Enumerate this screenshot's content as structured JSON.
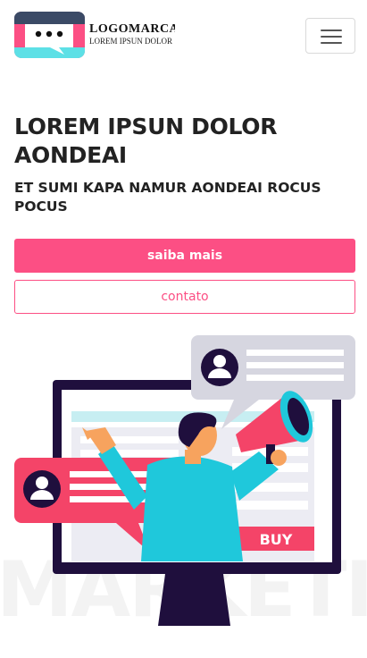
{
  "header": {
    "logo_name": "LOGOMARCA",
    "logo_tagline": "LOREM IPSUN DOLOR",
    "menu_icon": "hamburger-menu-icon"
  },
  "hero": {
    "title": "LOREM IPSUN DOLOR AONDEAI",
    "subtitle": "ET SUMI KAPA NAMUR AONDEAI ROCUS POCUS",
    "primary_button": "saiba mais",
    "secondary_button": "contato"
  },
  "illustration": {
    "buy_label": "BUY",
    "watermark": "MARKETING",
    "icons": [
      "user-avatar-icon",
      "megaphone-icon",
      "monitor-icon"
    ]
  },
  "colors": {
    "accent": "#fc4f84",
    "dark": "#1f0f3d",
    "teal": "#1fc8db",
    "bubble_gray": "#d6d6e0",
    "bubble_red": "#f44468"
  }
}
